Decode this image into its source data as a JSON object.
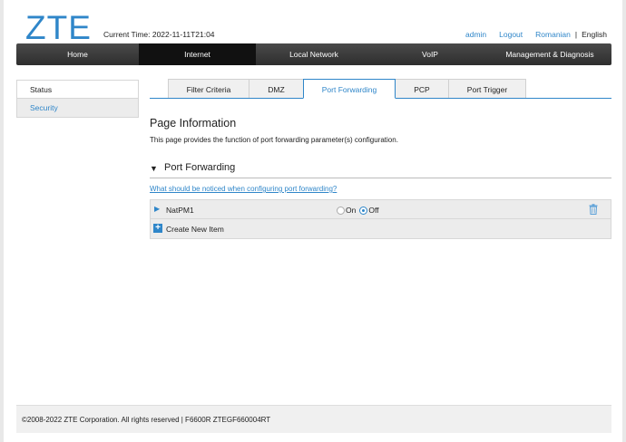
{
  "header": {
    "logo": "ZTE",
    "current_time": "Current Time: 2022-11-11T21:04",
    "user": "admin",
    "logout": "Logout",
    "lang_romanian": "Romanian",
    "lang_sep": "|",
    "lang_english": "English"
  },
  "nav": {
    "items": [
      {
        "label": "Home",
        "active": false
      },
      {
        "label": "Internet",
        "active": true
      },
      {
        "label": "Local Network",
        "active": false
      },
      {
        "label": "VoIP",
        "active": false
      },
      {
        "label": "Management & Diagnosis",
        "active": false
      }
    ]
  },
  "sidebar": {
    "items": [
      {
        "label": "Status"
      },
      {
        "label": "Security"
      }
    ]
  },
  "tabs": [
    {
      "label": "Filter Criteria",
      "active": false
    },
    {
      "label": "DMZ",
      "active": false
    },
    {
      "label": "Port Forwarding",
      "active": true
    },
    {
      "label": "PCP",
      "active": false
    },
    {
      "label": "Port Trigger",
      "active": false
    }
  ],
  "page": {
    "title": "Page Information",
    "description": "This page provides the function of port forwarding parameter(s) configuration."
  },
  "section": {
    "title": "Port Forwarding",
    "help_link": "What should be noticed when configuring port forwarding?",
    "rule": {
      "name": "NatPM1",
      "on_label": "On",
      "off_label": "Off",
      "selected": "Off"
    },
    "create_label": "Create New Item"
  },
  "footer": {
    "text": "©2008-2022 ZTE Corporation. All rights reserved  |   F6600R ZTEGF660004RT"
  },
  "colors": {
    "accent": "#2f86c9",
    "nav_bg": "#3a3a3a",
    "nav_active": "#111111"
  }
}
